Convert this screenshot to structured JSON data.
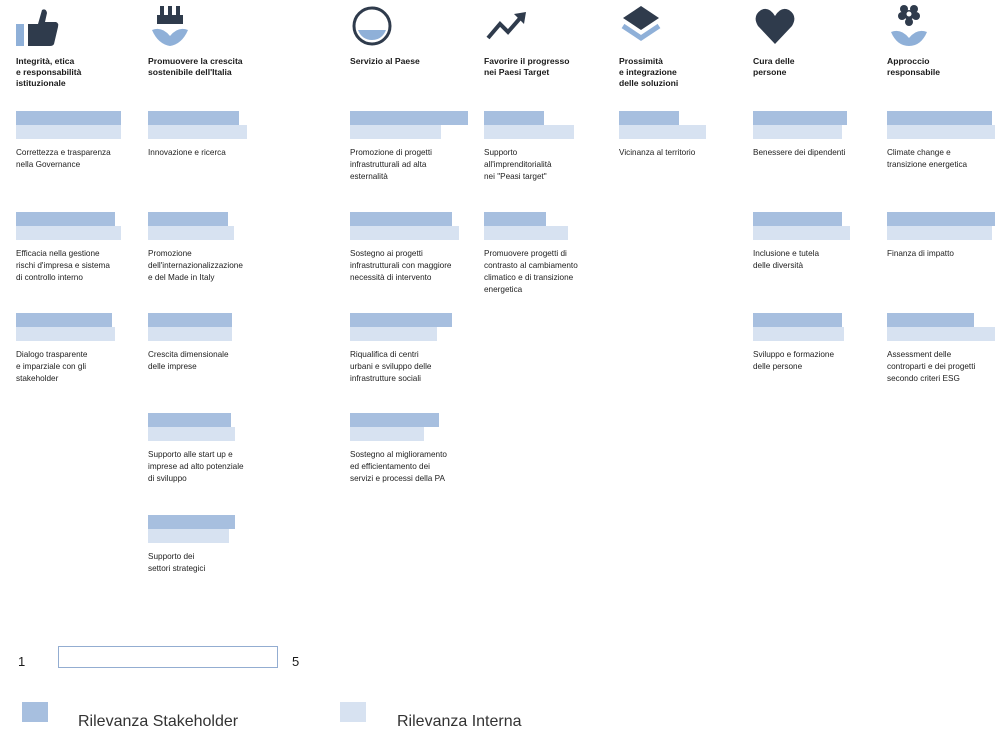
{
  "colors": {
    "stakeholder": "#a7bfdf",
    "interna": "#d7e2f1",
    "icon": "#2f3b4c",
    "icon_light": "#8fb0d8"
  },
  "chart_data": {
    "type": "bar",
    "scale": {
      "min": 1,
      "max": 5
    },
    "legend": [
      "Rilevanza Stakeholder",
      "Rilevanza Interna"
    ],
    "columns": [
      {
        "icon": "thumbs-up-icon",
        "title": "Integrità, etica\ne responsabilità\nistituzionale",
        "items": [
          {
            "label": "Correttezza e trasparenza\nnella Governance",
            "stakeholder": 4.55,
            "interna": 4.55
          },
          {
            "label": "Efficacia nella gestione\nrischi d'impresa e sistema\ndi controllo interno",
            "stakeholder": 4.35,
            "interna": 4.55
          },
          {
            "label": "Dialogo trasparente\ne imparziale con gli\nstakeholder",
            "stakeholder": 4.25,
            "interna": 4.35
          }
        ]
      },
      {
        "icon": "plug-sprout-icon",
        "title": "Promuovere la crescita\nsostenibile dell'Italia",
        "items": [
          {
            "label": "Innovazione e ricerca",
            "stakeholder": 4.1,
            "interna": 4.35
          },
          {
            "label": "Promozione\ndell'internazionalizzazione\ne del Made in Italy",
            "stakeholder": 3.7,
            "interna": 3.9
          },
          {
            "label": "Crescita dimensionale\ndelle imprese",
            "stakeholder": 3.85,
            "interna": 3.85
          },
          {
            "label": "Supporto alle start up e\nimprese ad alto potenziale\ndi sviluppo",
            "stakeholder": 3.8,
            "interna": 3.95
          },
          {
            "label": "Supporto dei\nsettori strategici",
            "stakeholder": 3.95,
            "interna": 3.75
          }
        ]
      },
      {
        "icon": "half-circle-icon",
        "title": "Servizio al Paese",
        "items": [
          {
            "label": "Promozione di progetti\ninfrastrutturali ad alta\nesternalità",
            "stakeholder": 5.0,
            "interna": 4.1
          },
          {
            "label": "Sostegno ai progetti\ninfrastrutturali con maggiore\nnecessità di intervento",
            "stakeholder": 4.45,
            "interna": 4.7
          },
          {
            "label": "Riqualifica di centri\nurbani e sviluppo delle\ninfrastrutture sociali",
            "stakeholder": 4.45,
            "interna": 3.95
          },
          {
            "label": "Sostegno al miglioramento\ned efficientamento dei\nservizi e processi della PA",
            "stakeholder": 4.0,
            "interna": 3.5
          }
        ]
      },
      {
        "icon": "trend-up-icon",
        "title": "Favorire il progresso\nnei Paesi Target",
        "items": [
          {
            "label": "Supporto\nall'imprenditorialità\nnei \"Peasi target\"",
            "stakeholder": 3.05,
            "interna": 4.05
          },
          {
            "label": "Promuovere progetti di\ncontrasto al cambiamento\nclimatico e di transizione\nenergetica",
            "stakeholder": 3.1,
            "interna": 3.85
          }
        ]
      },
      {
        "icon": "layers-icon",
        "title": "Prossimità\ne integrazione\ndelle soluzioni",
        "items": [
          {
            "label": "Vicinanza al territorio",
            "stakeholder": 3.05,
            "interna": 3.95
          }
        ]
      },
      {
        "icon": "heart-icon",
        "title": "Cura delle\npersone",
        "items": [
          {
            "label": "Benessere dei dipendenti",
            "stakeholder": 4.2,
            "interna": 4.0
          },
          {
            "label": "Inclusione e tutela\ndelle diversità",
            "stakeholder": 4.0,
            "interna": 4.3
          },
          {
            "label": "Sviluppo e formazione\ndelle persone",
            "stakeholder": 4.0,
            "interna": 4.1
          }
        ]
      },
      {
        "icon": "flower-hand-icon",
        "title": "Approccio\nresponsabile",
        "items": [
          {
            "label": "Climate change e\ntransizione energetica",
            "stakeholder": 4.55,
            "interna": 5.0
          },
          {
            "label": "Finanza di impatto",
            "stakeholder": 4.85,
            "interna": 4.55
          },
          {
            "label": "Assessment delle\ncontroparti e dei progetti\nsecondo criteri ESG",
            "stakeholder": 3.95,
            "interna": 4.85
          }
        ]
      }
    ]
  },
  "scale_label_min": "1",
  "scale_label_max": "5",
  "legend_stakeholder": "Rilevanza Stakeholder",
  "legend_interna": "Rilevanza Interna"
}
